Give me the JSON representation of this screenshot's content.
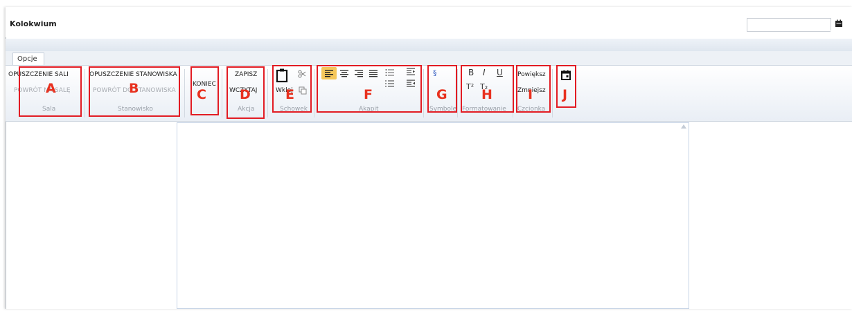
{
  "window": {
    "title": "Kolokwium"
  },
  "tabs": [
    {
      "label": "Opcje"
    }
  ],
  "ribbon": {
    "sala": {
      "buttons": [
        "OPUSZCZENIE SALI",
        "POWRÓT NA SALĘ"
      ],
      "label": "Sala"
    },
    "stanowisko": {
      "buttons": [
        "OPUSZCZENIE STANOWISKA",
        "POWRÓT DO STANOWISKA"
      ],
      "label": "Stanowisko"
    },
    "koniec": {
      "button": "KONIEC"
    },
    "akcja": {
      "buttons": [
        "ZAPISZ",
        "WCZYTAJ"
      ],
      "label": "Akcja"
    },
    "schowek": {
      "paste": "Wklej",
      "label": "Schowek"
    },
    "akapit": {
      "label": "Akapit"
    },
    "symbole": {
      "symbol": "§",
      "label": "Symbole"
    },
    "formatowanie": {
      "bold": "B",
      "italic": "I",
      "underline": "U",
      "superscript": "T²",
      "subscript": "T₂",
      "label": "Formatowanie"
    },
    "czcionka": {
      "buttons": [
        "Powiększ",
        "Zmniejsz"
      ],
      "label": "Czcionka"
    }
  },
  "annotations": [
    "A",
    "B",
    "C",
    "D",
    "E",
    "F",
    "G",
    "H",
    "I",
    "J"
  ],
  "colors": {
    "annotation": "#e21b23",
    "active_align": "#f5c75a",
    "ribbon_bg": "#e9eef5"
  }
}
